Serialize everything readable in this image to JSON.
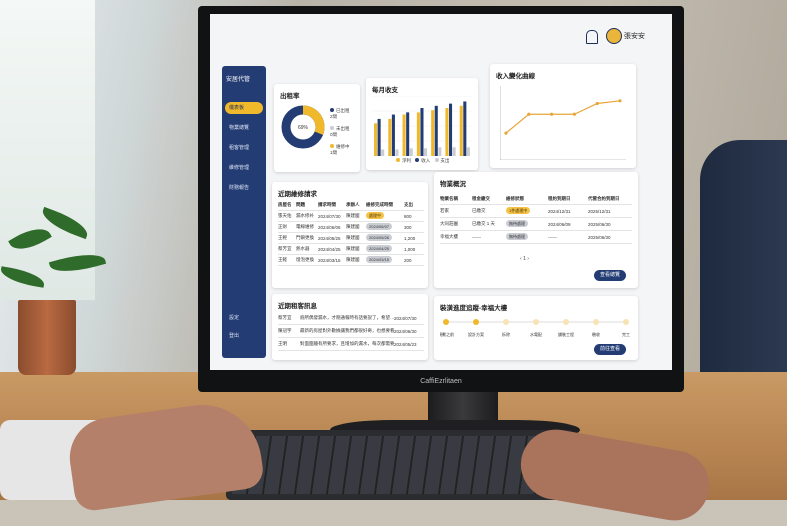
{
  "monitor_brand": "CaffiEzrlitaen",
  "header": {
    "user_name": "張安安"
  },
  "sidebar": {
    "logo": "安居代管",
    "items": [
      {
        "label": "儀表板"
      },
      {
        "label": "物業總覽"
      },
      {
        "label": "租客管理"
      },
      {
        "label": "維修管理"
      },
      {
        "label": "財務報告"
      }
    ],
    "bottom": [
      {
        "label": "設定"
      },
      {
        "label": "登出"
      }
    ]
  },
  "occupancy": {
    "title": "出租率",
    "center_label": "69%",
    "legend": [
      {
        "label": "已出租",
        "sub": "2間",
        "color": "#233c74"
      },
      {
        "label": "未出租",
        "sub": "0間",
        "color": "#c9ccd2"
      },
      {
        "label": "維修中",
        "sub": "1間",
        "color": "#f0b92c"
      }
    ],
    "slices": [
      0.69,
      0.0,
      0.31
    ]
  },
  "chart_data": [
    {
      "type": "bar",
      "title": "每月收支",
      "categories": [
        "1",
        "2",
        "3",
        "4",
        "5",
        "6",
        "7"
      ],
      "series": [
        {
          "name": "淨利",
          "color": "#f0b92c",
          "values": [
            30,
            34,
            38,
            40,
            42,
            44,
            46
          ]
        },
        {
          "name": "收入",
          "color": "#233c74",
          "values": [
            34,
            38,
            40,
            44,
            46,
            48,
            50
          ]
        },
        {
          "name": "支出",
          "color": "#c9ccd2",
          "values": [
            6,
            6,
            7,
            7,
            8,
            8,
            8
          ]
        }
      ],
      "ylim": [
        0,
        55
      ]
    },
    {
      "type": "line",
      "title": "收入變化曲線",
      "x": [
        1,
        2,
        3,
        4,
        5,
        6
      ],
      "series": [
        {
          "color": "#e8a63a",
          "values": [
            20,
            34,
            34,
            34,
            42,
            44
          ]
        }
      ],
      "ylim": [
        0,
        55
      ]
    }
  ],
  "repairs": {
    "title": "近期維修請求",
    "headers": [
      "房屋名",
      "問題",
      "請求時間",
      "承辦人",
      "維修完成時間",
      "支出"
    ],
    "rows": [
      {
        "c1": "張天佑",
        "c2": "漏水修补",
        "c3": "2024/07/30",
        "c4": "陳建國",
        "status": "處理中",
        "yellow": true,
        "c6": "800"
      },
      {
        "c1": "正財",
        "c2": "電線維修",
        "c3": "2024/06/06",
        "c4": "陳建國",
        "status": "2024/06/07",
        "yellow": false,
        "c6": "300"
      },
      {
        "c1": "王輕",
        "c2": "門鎖更換",
        "c3": "2024/05/25",
        "c4": "陳建國",
        "status": "2024/05/26",
        "yellow": false,
        "c6": "1,200"
      },
      {
        "c1": "蔡芳宜",
        "c2": "熱水器",
        "c3": "2024/04/25",
        "c4": "陳建國",
        "status": "2024/04/25",
        "yellow": false,
        "c6": "1,000"
      },
      {
        "c1": "王軽",
        "c2": "燈泡更換",
        "c3": "2024/03/15",
        "c4": "陳建國",
        "status": "2024/03/15",
        "yellow": false,
        "c6": "200"
      }
    ]
  },
  "properties": {
    "title": "物業概況",
    "headers": [
      "物業名稱",
      "租金繳交",
      "維修狀態",
      "租約到期日",
      "代管合約到期日"
    ],
    "rows": [
      {
        "c1": "若家",
        "c2": "已繳交",
        "status": "1件處理中",
        "yellow": true,
        "c4": "2024/12/31",
        "c5": "2025/12/31"
      },
      {
        "c1": "大同莊園",
        "c2": "已繳交 1 天",
        "status": "無待處理",
        "yellow": false,
        "c4": "2024/06/09",
        "c5": "2025/06/30"
      },
      {
        "c1": "幸福大樓",
        "c2": "------",
        "status": "無待處理",
        "yellow": false,
        "c4": "------",
        "c5": "2025/06/30"
      }
    ],
    "pager": "1",
    "button": "查看總覽"
  },
  "messages": {
    "title": "近期租客訊息",
    "rows": [
      {
        "name": "蔡芳宜",
        "text": "廁所偶發漏水，才剛通報時有話要說了，希望…",
        "date": "2024/07/30"
      },
      {
        "name": "陳冠宇",
        "text": "最新的房屋對外數據讓我們都很好奇，也想要看這…",
        "date": "2024/06/30"
      },
      {
        "name": "王明",
        "text": "對面圍牆有所要求，且增加的漏水，每次都需要處理…",
        "date": "2024/05/23"
      }
    ]
  },
  "progress": {
    "title": "裝潢進度追蹤-幸福大樓",
    "steps": [
      "規劃之前",
      "設計方案",
      "拆除",
      "水電配",
      "鋪裝工程",
      "驗收",
      "完工"
    ],
    "done": 2,
    "button": "前往查看"
  }
}
